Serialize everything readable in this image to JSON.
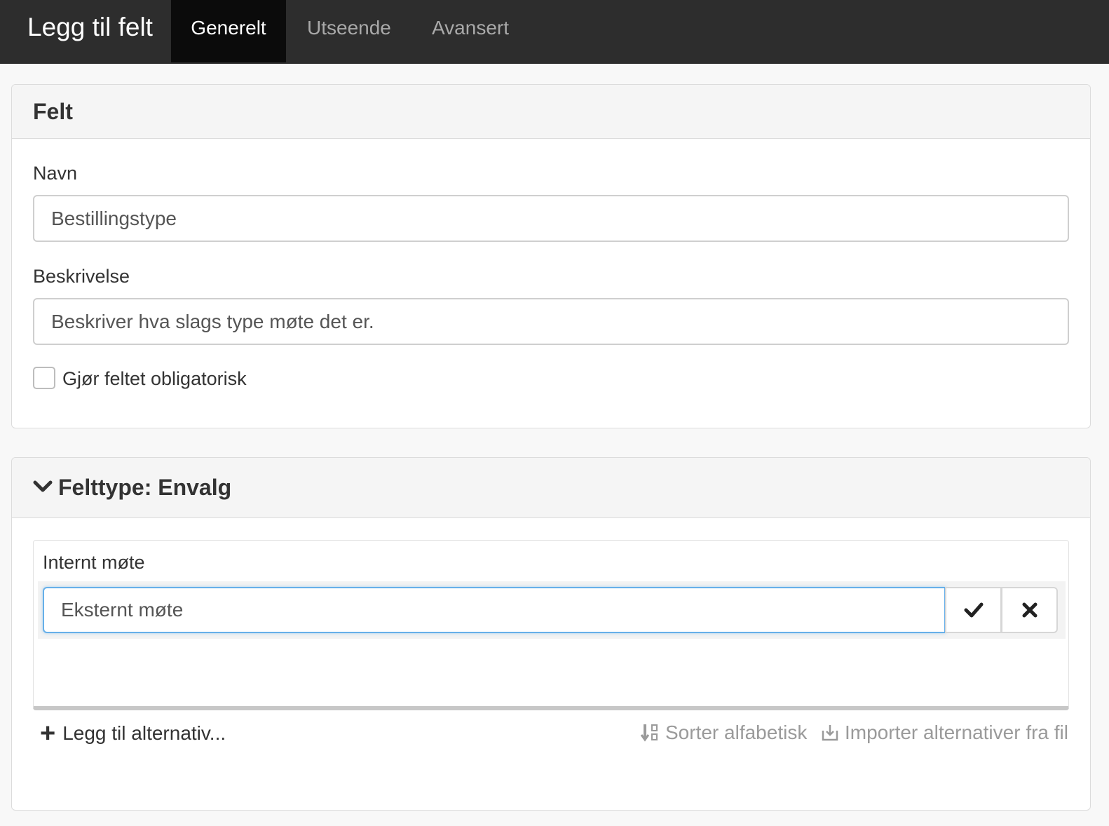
{
  "header": {
    "title": "Legg til felt",
    "tabs": [
      {
        "label": "Generelt",
        "active": true
      },
      {
        "label": "Utseende",
        "active": false
      },
      {
        "label": "Avansert",
        "active": false
      }
    ]
  },
  "field_panel": {
    "title": "Felt",
    "name_label": "Navn",
    "name_value": "Bestillingstype",
    "description_label": "Beskrivelse",
    "description_value": "Beskriver hva slags type møte det er.",
    "required_label": "Gjør feltet obligatorisk",
    "required_checked": false
  },
  "type_panel": {
    "title": "Felttype: Envalg",
    "chevron_icon": "chevron-down-icon",
    "options": [
      {
        "label": "Internt møte"
      }
    ],
    "editing_value": "Eksternt møte",
    "confirm_icon": "check-icon",
    "cancel_icon": "close-icon",
    "add_label": "Legg til alternativ...",
    "sort_label": "Sorter alfabetisk",
    "import_label": "Importer alternativer fra fil"
  },
  "colors": {
    "topbar": "#2d2d2d",
    "active_tab": "#0b0b0b",
    "focus_border": "#66afe9"
  }
}
